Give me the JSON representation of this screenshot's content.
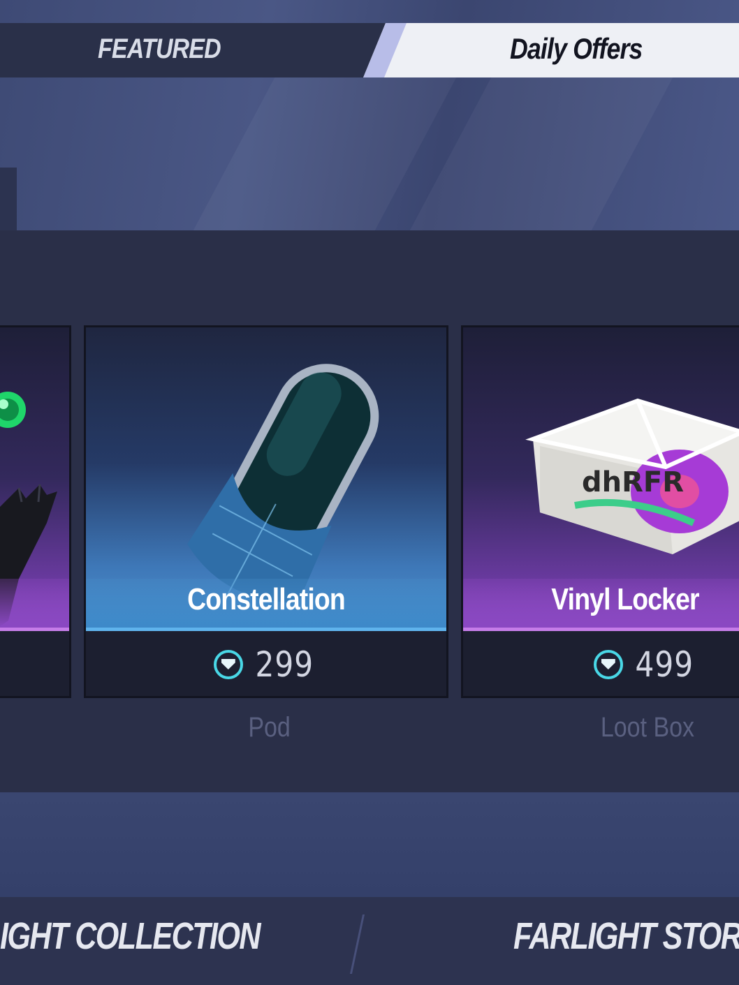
{
  "tabs": {
    "featured": "FEATURED",
    "daily_offers": "Daily Offers"
  },
  "cards": [
    {
      "name": "",
      "price": "",
      "category": ""
    },
    {
      "name": "Constellation",
      "price": "299",
      "category": "Pod",
      "icon": "pod-icon"
    },
    {
      "name": "Vinyl Locker",
      "price": "499",
      "category": "Loot Box",
      "icon": "loot-box-icon"
    }
  ],
  "currency_icon": "diamond-coin-icon",
  "bottom_nav": {
    "left": "IGHT COLLECTION",
    "right": "FARLIGHT STOR"
  },
  "colors": {
    "accent_cyan": "#49d7e6",
    "blue_rarity": "#3d89c9",
    "purple_rarity": "#8a48c2"
  }
}
